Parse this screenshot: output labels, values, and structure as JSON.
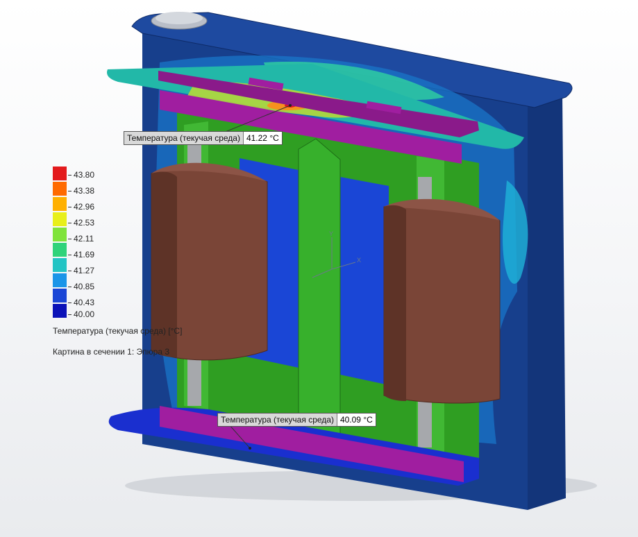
{
  "legend": {
    "values": [
      "43.80",
      "43.38",
      "42.96",
      "42.53",
      "42.11",
      "41.69",
      "41.27",
      "40.85",
      "40.43",
      "40.00"
    ],
    "colors": [
      "#e31a1c",
      "#ff6a00",
      "#ffb000",
      "#e8ef1a",
      "#7fe33a",
      "#2fd37a",
      "#22c4c4",
      "#1a95e8",
      "#1a46d6",
      "#0b12b8"
    ],
    "title": "Температура (текучая среда) [°C]",
    "subtitle": "Картина в сечении 1: Эпюра 3"
  },
  "probes": [
    {
      "label": "Температура (текучая среда)",
      "value": "41.22 °C"
    },
    {
      "label": "Температура (текучая среда)",
      "value": "40.09 °C"
    }
  ],
  "axis": {
    "y": "Y",
    "x": "X"
  }
}
